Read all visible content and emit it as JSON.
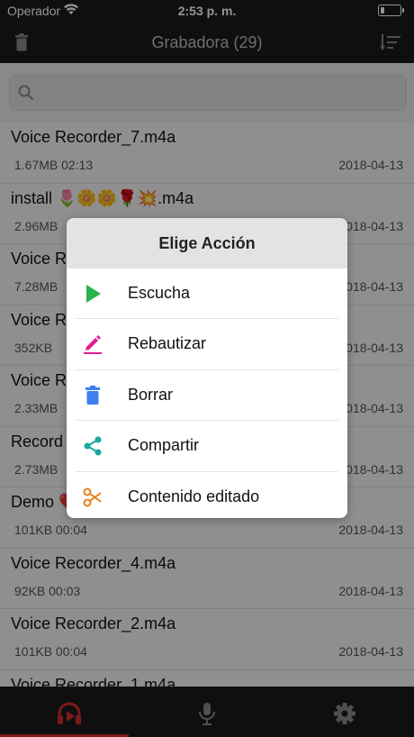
{
  "status": {
    "carrier": "Operador",
    "time": "2:53 p. m."
  },
  "navbar": {
    "title": "Grabadora (29)"
  },
  "search": {
    "placeholder": ""
  },
  "recordings": [
    {
      "name": "Voice Recorder_7.m4a",
      "meta": "1.67MB 02:13",
      "date": "2018-04-13"
    },
    {
      "name": "install 🌷🌼🌼🌹💥.m4a",
      "meta": "2.96MB",
      "date": "2018-04-13"
    },
    {
      "name": "Voice R",
      "meta": "7.28MB",
      "date": "2018-04-13"
    },
    {
      "name": "Voice R",
      "meta": "352KB",
      "date": "2018-04-13"
    },
    {
      "name": "Voice R",
      "meta": "2.33MB",
      "date": "2018-04-13"
    },
    {
      "name": "Record",
      "meta": "2.73MB",
      "date": "2018-04-13"
    },
    {
      "name": "Demo ❤️",
      "meta": "101KB 00:04",
      "date": "2018-04-13"
    },
    {
      "name": "Voice Recorder_4.m4a",
      "meta": "92KB 00:03",
      "date": "2018-04-13"
    },
    {
      "name": "Voice Recorder_2.m4a",
      "meta": "101KB 00:04",
      "date": "2018-04-13"
    },
    {
      "name": "Voice Recorder_1.m4a",
      "meta": "",
      "date": ""
    }
  ],
  "dialog": {
    "title": "Elige Acción",
    "actions": [
      {
        "label": "Escucha",
        "icon": "play-icon",
        "color": "#2bb24c"
      },
      {
        "label": "Rebautizar",
        "icon": "pencil-icon",
        "color": "#e01e8f"
      },
      {
        "label": "Borrar",
        "icon": "trash-icon",
        "color": "#3d7ef0"
      },
      {
        "label": "Compartir",
        "icon": "share-icon",
        "color": "#1aa79c"
      },
      {
        "label": "Contenido editado",
        "icon": "scissors-icon",
        "color": "#e8801a"
      }
    ]
  },
  "tabbar": {
    "tabs": [
      {
        "name": "player",
        "icon": "headphones-play-icon",
        "active": true
      },
      {
        "name": "record",
        "icon": "microphone-icon",
        "active": false
      },
      {
        "name": "settings",
        "icon": "gear-icon",
        "active": false
      }
    ],
    "accent": "#d62c2c"
  }
}
